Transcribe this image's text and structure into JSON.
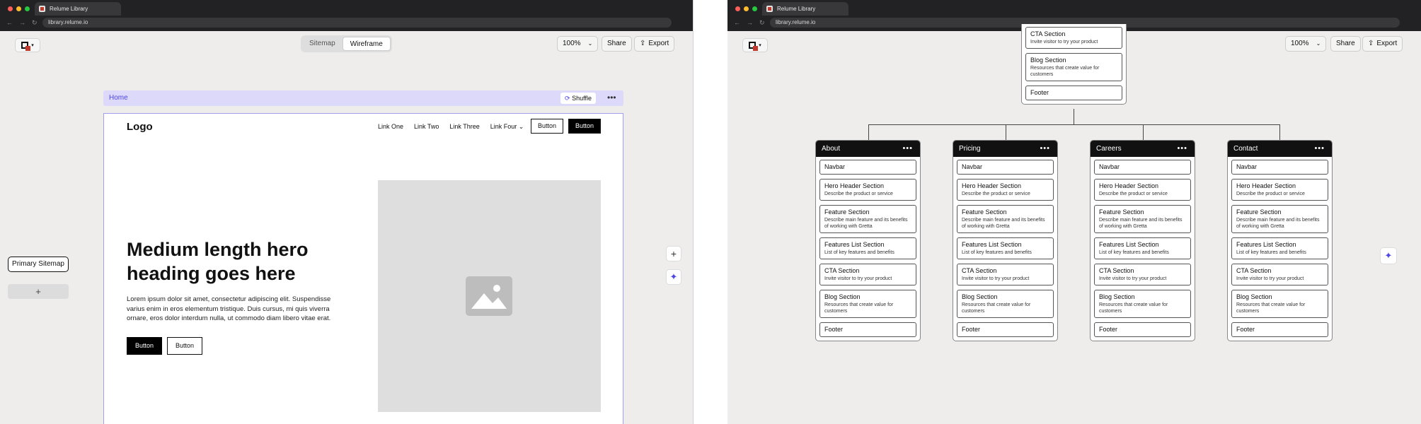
{
  "browser": {
    "tab_title": "Relume Library",
    "url": "library.relume.io"
  },
  "toolbar": {
    "sitemap_tab": "Sitemap",
    "wireframe_tab": "Wireframe",
    "zoom": "100%",
    "share": "Share",
    "export": "Export"
  },
  "sidebar": {
    "primary_sitemap": "Primary Sitemap",
    "add": "+"
  },
  "wireframe": {
    "breadcrumb": "Home",
    "shuffle": "Shuffle",
    "more": "•••",
    "logo": "Logo",
    "nav_links": [
      "Link One",
      "Link Two",
      "Link Three",
      "Link Four"
    ],
    "nav_button_secondary": "Button",
    "nav_button_primary": "Button",
    "hero_heading": "Medium length hero heading goes here",
    "hero_body": "Lorem ipsum dolor sit amet, consectetur adipiscing elit. Suspendisse varius enim in eros elementum tristique. Duis cursus, mi quis viverra ornare, eros dolor interdum nulla, ut commodo diam libero vitae erat.",
    "hero_button_primary": "Button",
    "hero_button_secondary": "Button"
  },
  "side_tools": {
    "add": "+",
    "ai": "✦"
  },
  "sitemap": {
    "home_partial": [
      {
        "title": "CTA Section",
        "desc": "Invite visitor to try your product"
      },
      {
        "title": "Blog Section",
        "desc": "Resources that create value for customers"
      },
      {
        "title": "Footer",
        "desc": ""
      }
    ],
    "pages": [
      {
        "name": "About",
        "sections": [
          {
            "title": "Navbar",
            "desc": ""
          },
          {
            "title": "Hero Header Section",
            "desc": "Describe the product or service"
          },
          {
            "title": "Feature Section",
            "desc": "Describe main feature and its benefits of working with Gretta"
          },
          {
            "title": "Features List Section",
            "desc": "List of key features and benefits"
          },
          {
            "title": "CTA Section",
            "desc": "Invite visitor to try your product"
          },
          {
            "title": "Blog Section",
            "desc": "Resources that create value for customers"
          },
          {
            "title": "Footer",
            "desc": ""
          }
        ]
      },
      {
        "name": "Pricing",
        "sections": [
          {
            "title": "Navbar",
            "desc": ""
          },
          {
            "title": "Hero Header Section",
            "desc": "Describe the product or service"
          },
          {
            "title": "Feature Section",
            "desc": "Describe main feature and its benefits of working with Gretta"
          },
          {
            "title": "Features List Section",
            "desc": "List of key features and benefits"
          },
          {
            "title": "CTA Section",
            "desc": "Invite visitor to try your product"
          },
          {
            "title": "Blog Section",
            "desc": "Resources that create value for customers"
          },
          {
            "title": "Footer",
            "desc": ""
          }
        ]
      },
      {
        "name": "Careers",
        "sections": [
          {
            "title": "Navbar",
            "desc": ""
          },
          {
            "title": "Hero Header Section",
            "desc": "Describe the product or service"
          },
          {
            "title": "Feature Section",
            "desc": "Describe main feature and its benefits of working with Gretta"
          },
          {
            "title": "Features List Section",
            "desc": "List of key features and benefits"
          },
          {
            "title": "CTA Section",
            "desc": "Invite visitor to try your product"
          },
          {
            "title": "Blog Section",
            "desc": "Resources that create value for customers"
          },
          {
            "title": "Footer",
            "desc": ""
          }
        ]
      },
      {
        "name": "Contact",
        "sections": [
          {
            "title": "Navbar",
            "desc": ""
          },
          {
            "title": "Hero Header Section",
            "desc": "Describe the product or service"
          },
          {
            "title": "Feature Section",
            "desc": "Describe main feature and its benefits of working with Gretta"
          },
          {
            "title": "Features List Section",
            "desc": "List of key features and benefits"
          },
          {
            "title": "CTA Section",
            "desc": "Invite visitor to try your product"
          },
          {
            "title": "Blog Section",
            "desc": "Resources that create value for customers"
          },
          {
            "title": "Footer",
            "desc": ""
          }
        ]
      }
    ],
    "card_more": "•••"
  },
  "colors": {
    "accent": "#4f46e5",
    "breadcrumb_bg": "#dcd9fb",
    "chrome": "#222224",
    "canvas": "#eeedec"
  }
}
